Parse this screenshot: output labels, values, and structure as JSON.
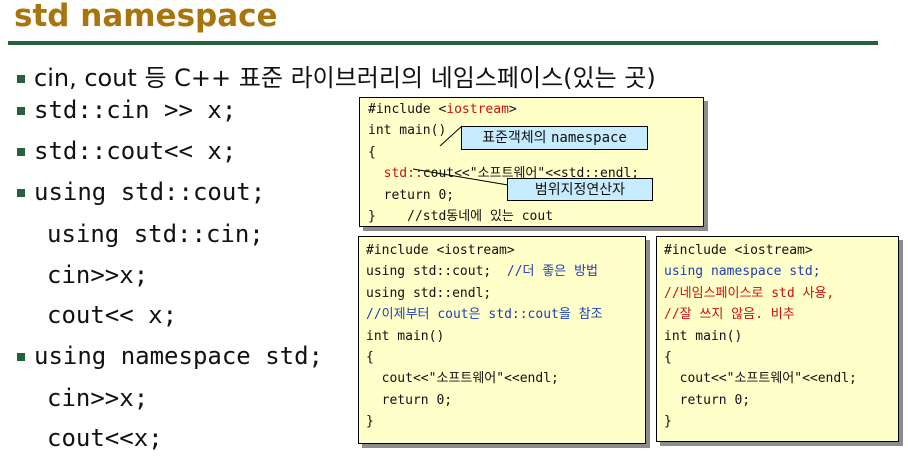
{
  "title": "std namespace",
  "bullets": [
    {
      "text": "cin, cout 등 C++ 표준 라이브러리의 네임스페이스(있는 곳)",
      "mono": false
    },
    {
      "text": "std::cin >> x;",
      "mono": true
    },
    {
      "text": "std::cout<< x;",
      "mono": true
    },
    {
      "text": "using std::cout;",
      "mono": true
    },
    {
      "text": "using std::cin;",
      "mono": true,
      "indent": true
    },
    {
      "text": "cin>>x;",
      "mono": true,
      "indent": true
    },
    {
      "text": "cout<< x;",
      "mono": true,
      "indent": true
    },
    {
      "text": "using namespace std;",
      "mono": true
    },
    {
      "text": "cin>>x;",
      "mono": true,
      "indent": true
    },
    {
      "text": "cout<<x;",
      "mono": true,
      "indent": true
    }
  ],
  "box1": {
    "l1a": "#include <",
    "l1b": "iostream",
    "l1c": ">",
    "l2": "int main()",
    "l3": "{",
    "l4a": "  ",
    "l4b": "std::",
    "l4c": "cout<<\"소프트웨어\"<<std::endl;",
    "l5": "  return 0;",
    "l6": "}    //std동네에 있는 cout",
    "callout1a": "표준객체의 ",
    "callout1b": "namespace",
    "callout2": "범위지정연산자"
  },
  "box2": {
    "lines": [
      {
        "text": "#include <iostream>",
        "c": ""
      },
      {
        "text": "using std::cout;  ",
        "c": "",
        "tail": "//더 좋은 방법",
        "tc": "blue"
      },
      {
        "text": "using std::endl;",
        "c": ""
      },
      {
        "text": "//이제부터 cout은 std::cout을 참조",
        "c": "blue"
      },
      {
        "text": "int main()",
        "c": ""
      },
      {
        "text": "{",
        "c": ""
      },
      {
        "text": "  cout<<\"소프트웨어\"<<endl;",
        "c": ""
      },
      {
        "text": "  return 0;",
        "c": ""
      },
      {
        "text": "}",
        "c": ""
      }
    ]
  },
  "box3": {
    "lines": [
      {
        "text": "#include <iostream>",
        "c": ""
      },
      {
        "text": "using namespace std;",
        "c": "blue"
      },
      {
        "text": "//네임스페이스로 std 사용,",
        "c": "red"
      },
      {
        "text": "//잘 쓰지 않음. 비추",
        "c": "red"
      },
      {
        "text": "int main()",
        "c": ""
      },
      {
        "text": "{",
        "c": ""
      },
      {
        "text": "  cout<<\"소프트웨어\"<<endl;",
        "c": ""
      },
      {
        "text": "  return 0;",
        "c": ""
      },
      {
        "text": "}",
        "c": ""
      }
    ]
  }
}
